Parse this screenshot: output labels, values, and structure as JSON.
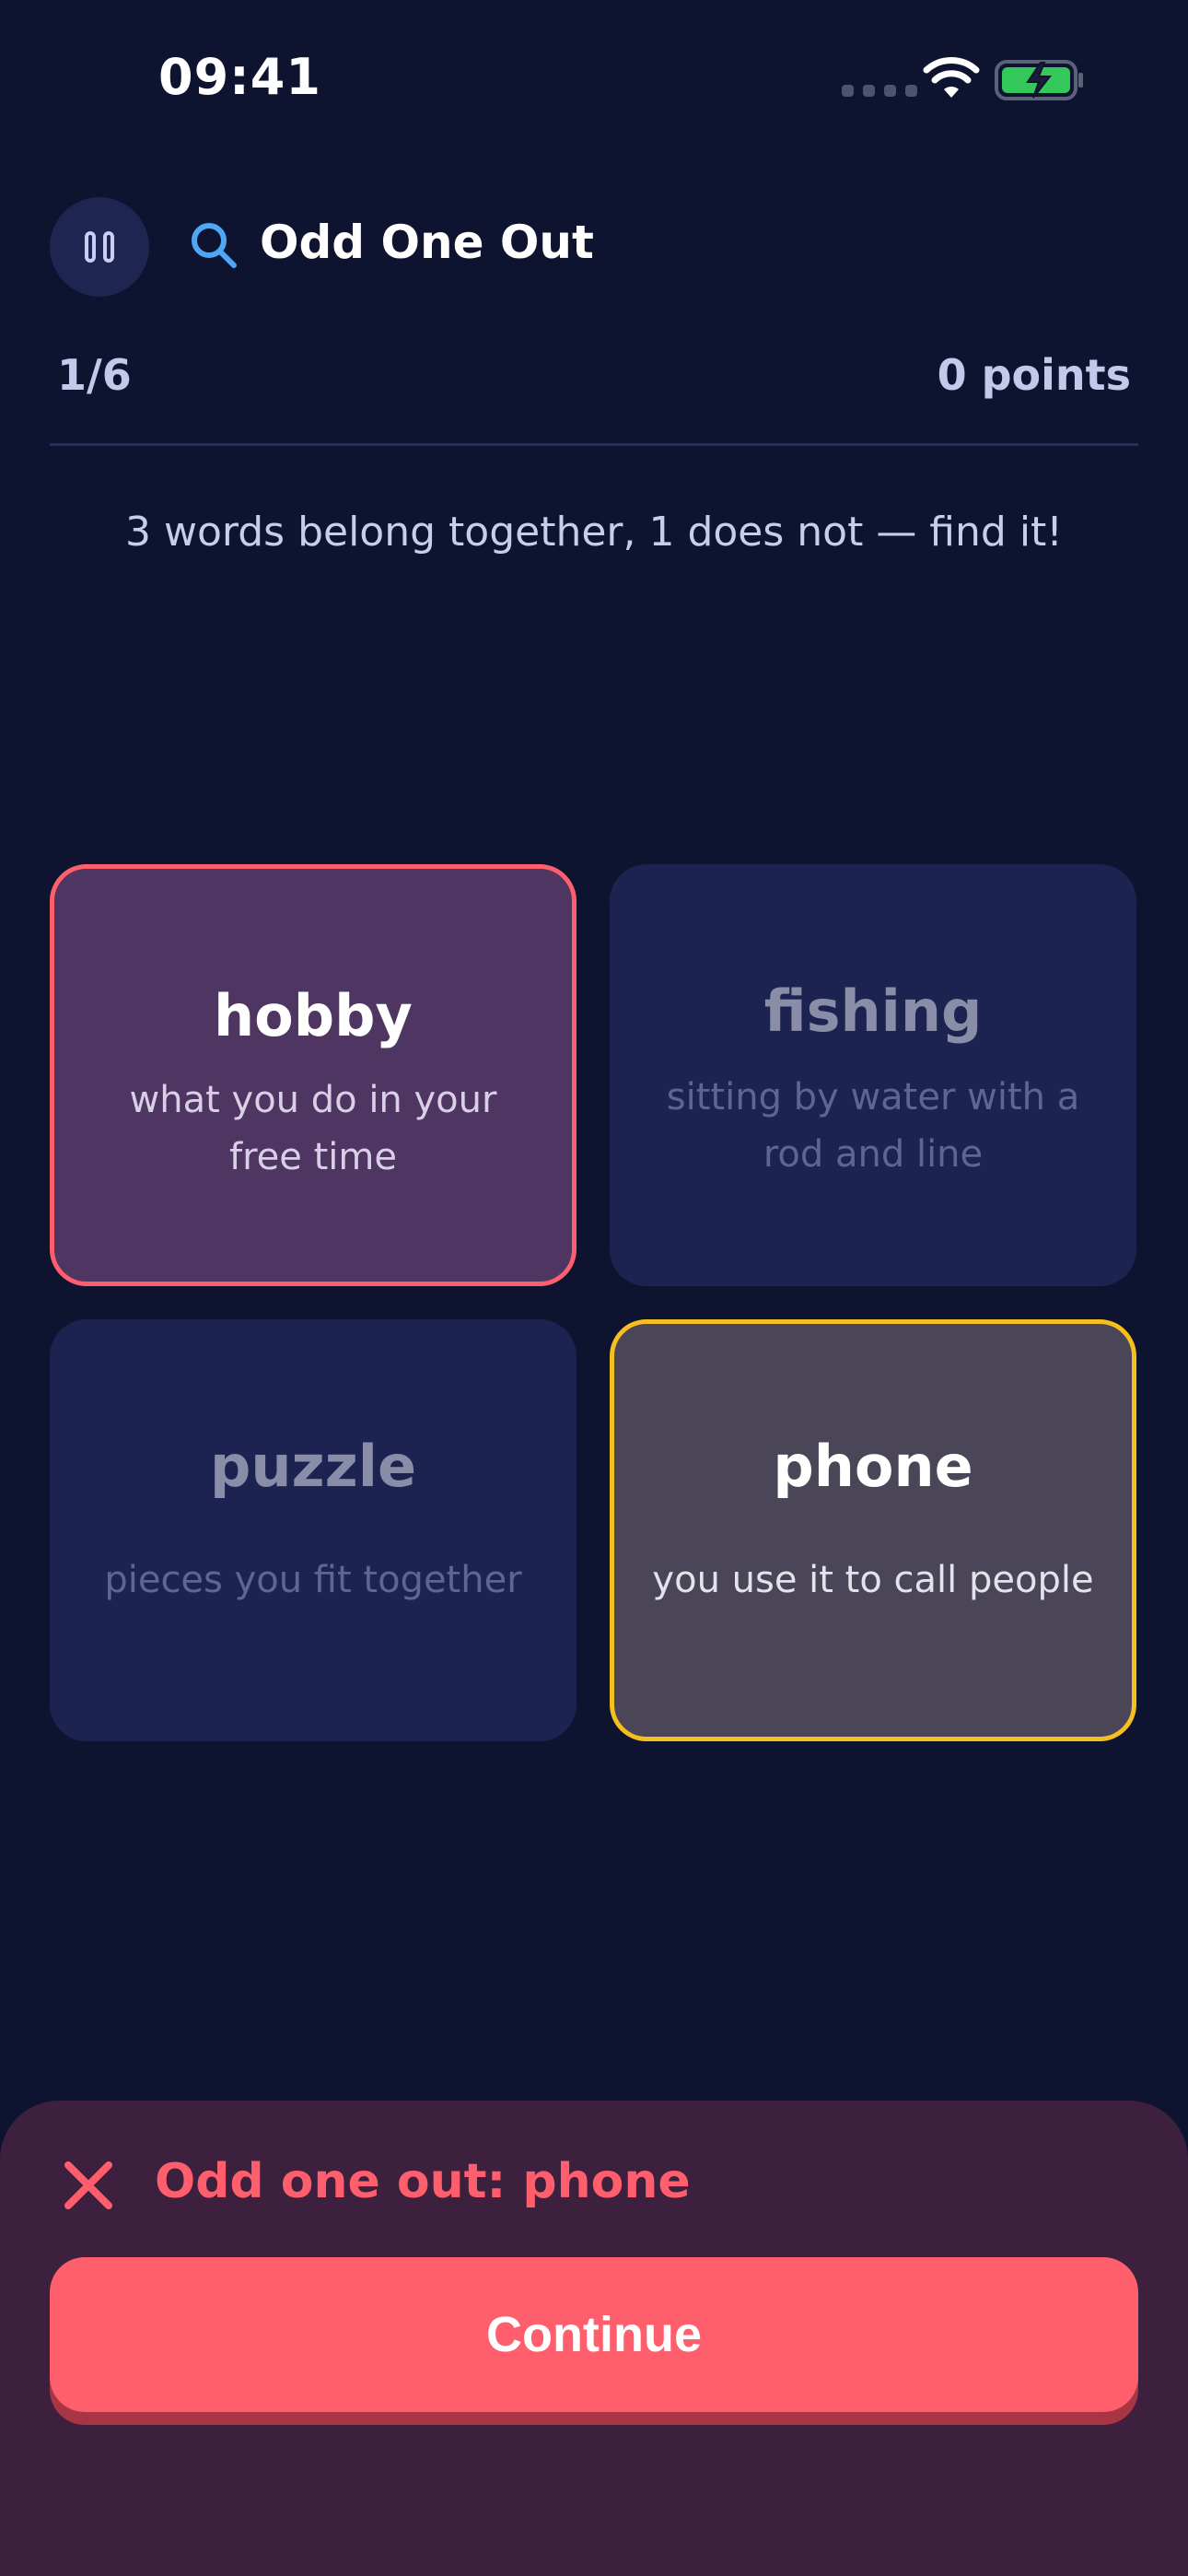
{
  "status_bar": {
    "time": "09:41",
    "icons": [
      "signal-icon",
      "wifi-icon",
      "battery-charging-icon"
    ]
  },
  "header": {
    "pause_icon": "pause-icon",
    "search_icon": "search-icon",
    "title": "Odd One Out"
  },
  "progress": {
    "label": "1/6",
    "points": "0 points"
  },
  "instructions": "3 words belong together, 1 does not — find it!",
  "cards": [
    {
      "word": "hobby",
      "hint_line1": "what you do in your",
      "hint_line2": "free time",
      "state": "selected-wrong"
    },
    {
      "word": "fishing",
      "hint_line1": "sitting by water with a",
      "hint_line2": "rod and line",
      "state": "dimmed"
    },
    {
      "word": "puzzle",
      "hint_line1": "pieces you fit together",
      "hint_line2": "",
      "state": "dimmed"
    },
    {
      "word": "phone",
      "hint_line1": "you use it to call people",
      "hint_line2": "",
      "state": "correct-answer"
    }
  ],
  "feedback": {
    "icon": "x-icon",
    "text": "Odd one out: phone",
    "button_label": "Continue"
  },
  "colors": {
    "background": "#0e1330",
    "card": "#1c2350",
    "selected_card": "#4e3562",
    "error": "#ff5e6c",
    "answer_border": "#f5bf1e",
    "feedback_sheet": "#3d1f3e",
    "battery": "#34c759"
  }
}
